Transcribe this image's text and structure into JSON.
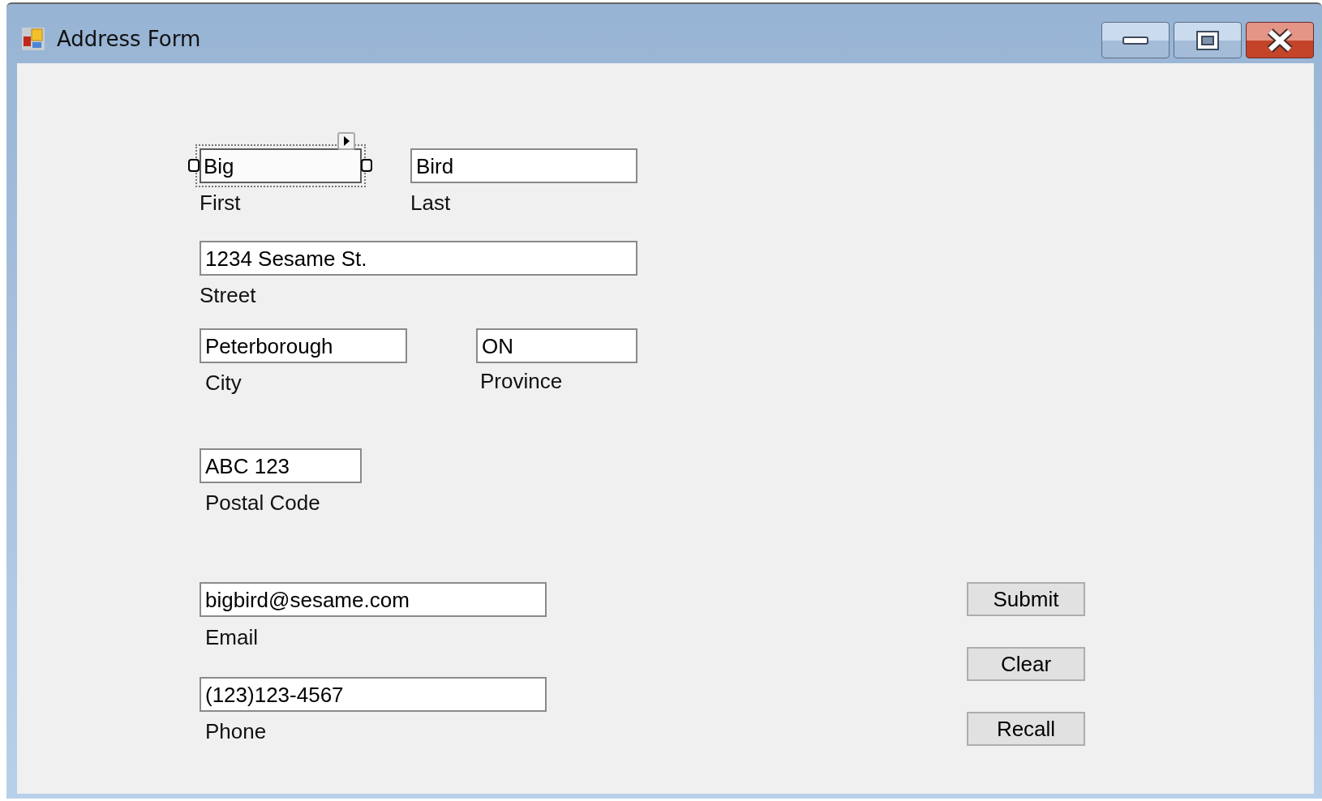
{
  "window": {
    "title": "Address Form"
  },
  "fields": [
    {
      "value": "Big",
      "label": "First",
      "selected": true
    },
    {
      "value": "Bird",
      "label": "Last",
      "selected": false
    },
    {
      "value": "1234 Sesame St.",
      "label": "Street",
      "selected": false
    },
    {
      "value": "Peterborough",
      "label": "City",
      "selected": false
    },
    {
      "value": "ON",
      "label": "Province",
      "selected": false
    },
    {
      "value": "ABC 123",
      "label": "Postal Code",
      "selected": false
    },
    {
      "value": "bigbird@sesame.com",
      "label": "Email",
      "selected": false
    },
    {
      "value": "(123)123-4567",
      "label": "Phone",
      "selected": false
    }
  ],
  "buttons": [
    "Submit",
    "Clear",
    "Recall"
  ]
}
